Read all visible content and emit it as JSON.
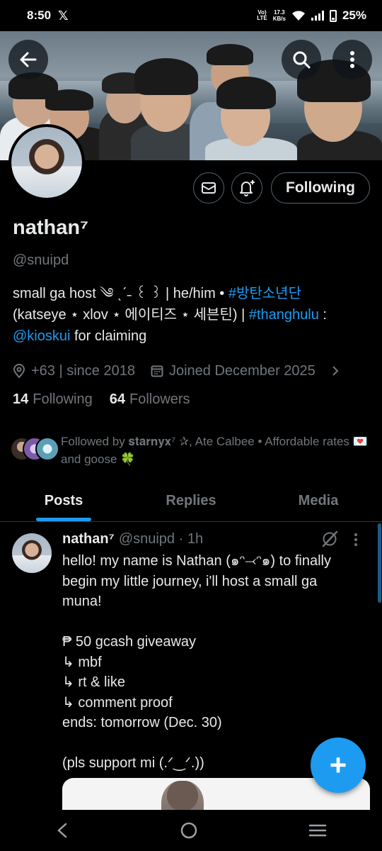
{
  "status_bar": {
    "time": "8:50",
    "x_logo": "𝕏",
    "volte": "Vo)\nLTE",
    "net_speed_value": "17.3",
    "net_speed_unit": "KB/s",
    "battery": "25%"
  },
  "header": {
    "back_icon": "arrow-left-icon",
    "search_icon": "search-icon",
    "more_icon": "more-vertical-icon"
  },
  "profile": {
    "display_name": "nathan⁷",
    "handle": "@snuipd",
    "follow_button": "Following",
    "bio_line1_prefix": "small ga host ༄ ˎˊ˗ ꒰ ꒱ | he/him • ",
    "bio_hashtag1": "#방탄소년단",
    "bio_line2_prefix": "(katseye ⋆ xlov ⋆ 에이티즈 ⋆ 세븐틴) | ",
    "bio_hashtag2": "#thanghulu",
    "bio_line2_suffix": " :",
    "bio_mention": "@kioskui",
    "bio_line3_suffix": " for claiming",
    "location": "+63 | since 2018",
    "joined": "Joined December 2025",
    "following_count": "14",
    "following_label": "Following",
    "followers_count": "64",
    "followers_label": "Followers",
    "followed_by": "Followed by 𝐬𝐭𝐚𝐫𝐧𝐲𝐱⁷ ✰, Ate Calbee • Affordable rates 💌 and goose 🍀"
  },
  "tabs": [
    "Posts",
    "Replies",
    "Media"
  ],
  "post": {
    "name": "nathan⁷",
    "meta": "@snuipd · 1h",
    "body": "hello! my name is Nathan (๑ᵔ⤙ᵔ๑) to finally begin my little journey, i'll host a small ga muna!\n\n₱ 50 gcash giveaway\n↳ mbf\n↳ rt & like\n↳ comment proof\nends: tomorrow (Dec. 30)\n\n(pls support mi (.ᐟ‿ᐟ.))"
  },
  "fab_label": "+",
  "colors": {
    "accent": "#1d9bf0",
    "background": "#000000",
    "text_primary": "#e7e9ea",
    "text_secondary": "#71767b"
  }
}
